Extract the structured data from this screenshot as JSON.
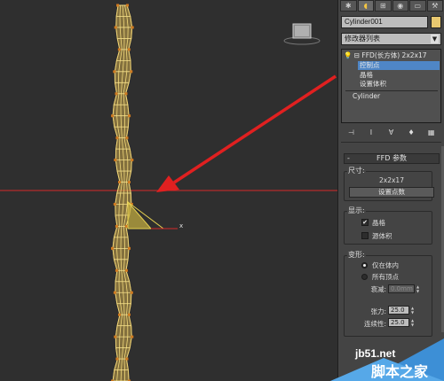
{
  "command_panel": {
    "tabs": [
      {
        "icon": "create-icon",
        "glyph": "✱"
      },
      {
        "icon": "modify-icon",
        "glyph": "◖"
      },
      {
        "icon": "hierarchy-icon",
        "glyph": "⊞"
      },
      {
        "icon": "motion-icon",
        "glyph": "◉"
      },
      {
        "icon": "display-icon",
        "glyph": "▭"
      },
      {
        "icon": "utilities-icon",
        "glyph": "⚒"
      }
    ],
    "object_name": "Cylinder001",
    "object_color": "#e8c870",
    "modifier_list_label": "修改器列表",
    "stack": {
      "ffd": "FFD(长方体) 2x2x17",
      "control_points": "控制点",
      "lattice": "晶格",
      "set_volume": "设置体积",
      "base": "Cylinder"
    },
    "stack_tools": [
      "pin-stack-icon",
      "show-end-result-icon",
      "make-unique-icon",
      "remove-modifier-icon",
      "configure-sets-icon"
    ],
    "rollout": {
      "title": "FFD 参数",
      "toggle": "-",
      "dimensions_group": "尺寸:",
      "dimensions_value": "2x2x17",
      "set_points_button": "设置点数",
      "display_group": "显示:",
      "lattice_checkbox": "晶格",
      "lattice_checked": true,
      "source_volume_checkbox": "源体积",
      "source_volume_checked": false,
      "deform_group": "变形:",
      "only_in_volume": "仅在体内",
      "all_vertices": "所有顶点",
      "selected_radio": "only_in_volume",
      "falloff_label": "衰减:",
      "falloff_value": "0.0mm",
      "tension_label": "张力:",
      "tension_value": "25.0",
      "continuity_label": "连续性:",
      "continuity_value": "25.0"
    }
  },
  "viewport": {
    "gizmo_axis_label": "x",
    "accent_color": "#e03030",
    "mesh_color": "#e8c060"
  },
  "watermark": {
    "site": "jb51.net",
    "brand": "脚本之家"
  }
}
